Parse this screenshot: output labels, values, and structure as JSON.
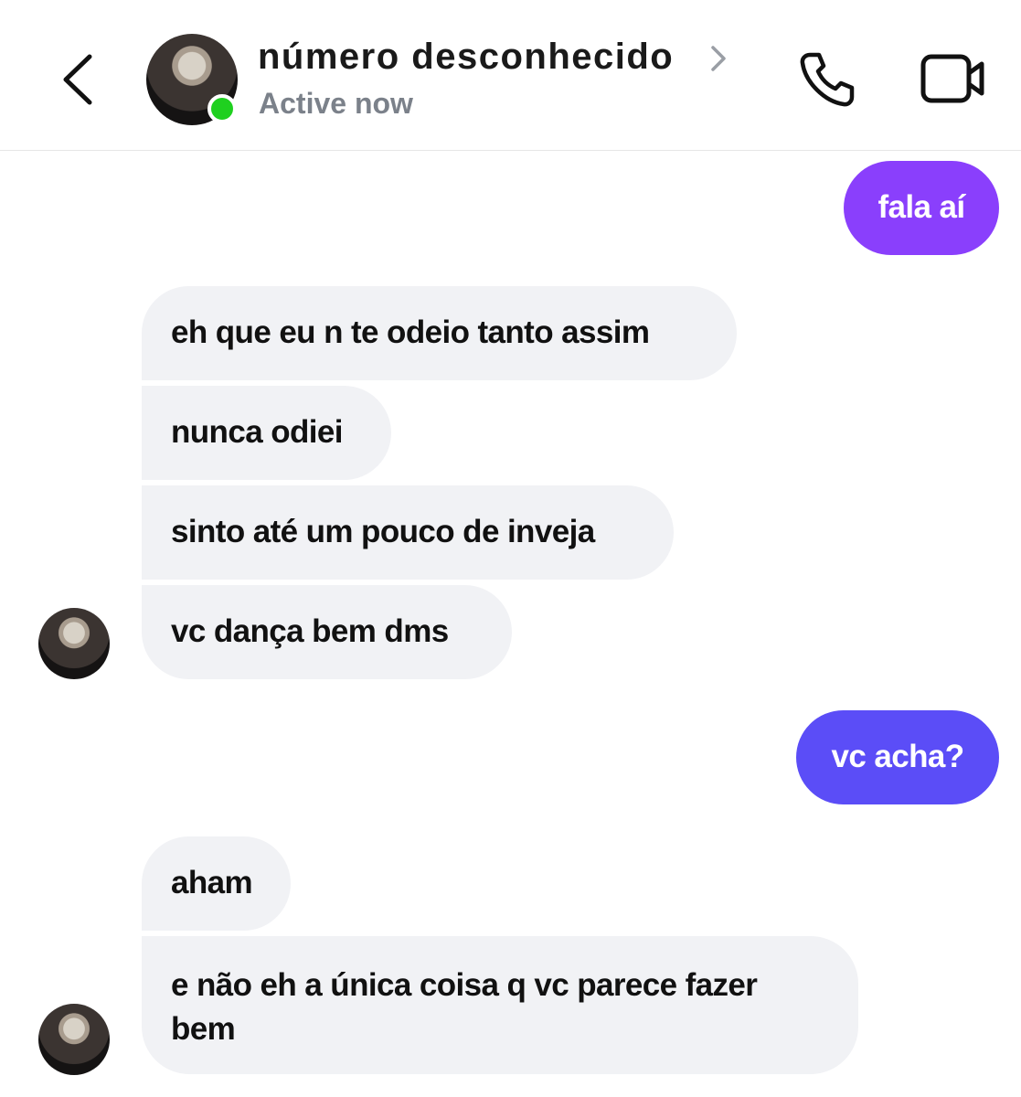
{
  "header": {
    "contact_name": "número desconhecido",
    "status": "Active now",
    "online_color": "#1fd01f",
    "icons": {
      "back": "chevron-left-icon",
      "details": "chevron-right-icon",
      "call": "phone-icon",
      "video": "video-camera-icon"
    }
  },
  "messages": [
    {
      "sender": "me",
      "text": "fala aí",
      "color": "#8a3ffc"
    },
    {
      "sender": "contact",
      "text": "eh que eu n te odeio tanto assim"
    },
    {
      "sender": "contact",
      "text": "nunca odiei"
    },
    {
      "sender": "contact",
      "text": "sinto até um pouco de inveja"
    },
    {
      "sender": "contact",
      "text": "vc dança bem dms"
    },
    {
      "sender": "me",
      "text": "vc acha?",
      "color": "#5b4df7"
    },
    {
      "sender": "contact",
      "text": "aham"
    },
    {
      "sender": "contact",
      "text": "e não eh a única coisa q vc parece fazer bem"
    }
  ],
  "colors": {
    "incoming_bubble": "#f1f2f5",
    "status_text": "#7b818a",
    "outgoing_gradient": [
      "#8a3ffc",
      "#5b4df7"
    ]
  }
}
